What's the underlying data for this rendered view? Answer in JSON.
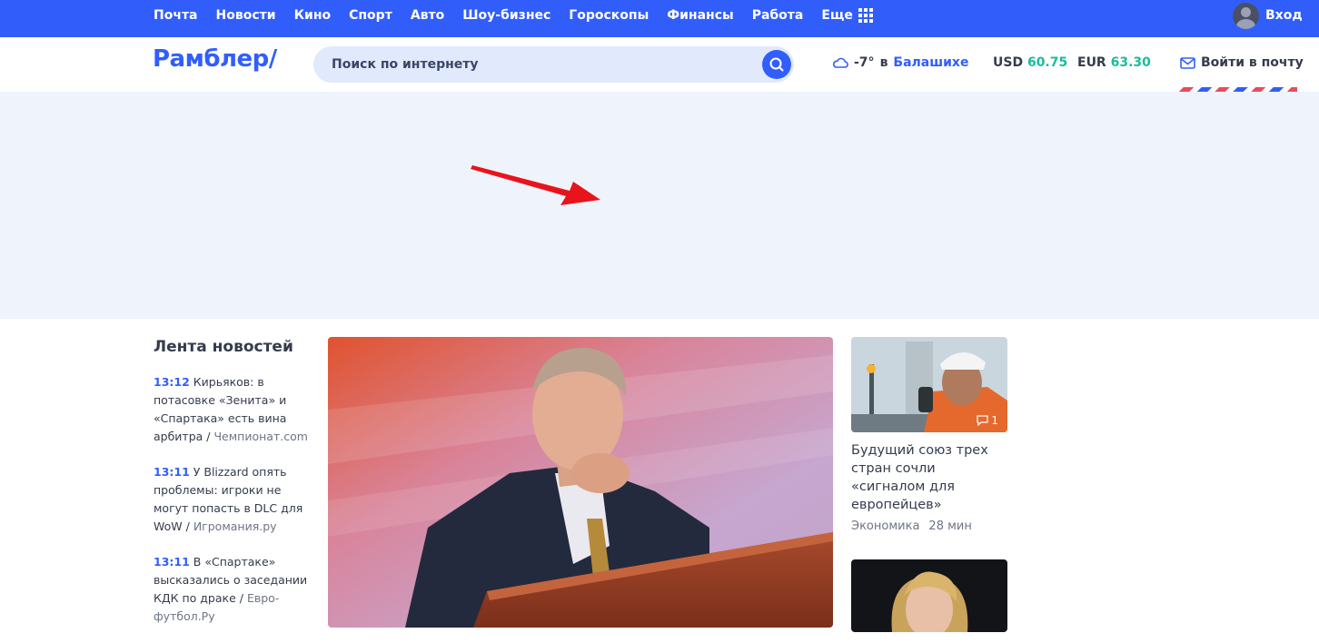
{
  "topnav": {
    "items": [
      "Почта",
      "Новости",
      "Кино",
      "Спорт",
      "Авто",
      "Шоу-бизнес",
      "Гороскопы",
      "Финансы",
      "Работа"
    ],
    "more_label": "Еще",
    "login_label": "Вход"
  },
  "header": {
    "logo": "Рамблер/",
    "search_placeholder": "Поиск по интернету",
    "weather": {
      "temp": "-7°",
      "prep": "в",
      "city": "Балашихе"
    },
    "currencies": [
      {
        "code": "USD",
        "value": "60.75"
      },
      {
        "code": "EUR",
        "value": "63.30"
      }
    ],
    "mail_label": "Войти в почту"
  },
  "colors": {
    "brand": "#315efb",
    "accent_green": "#1bbc9b",
    "ad_bg": "#eef3fc",
    "arrow": "#e8141c"
  },
  "feed": {
    "title": "Лента новостей",
    "items": [
      {
        "time": "13:12",
        "text": "Кирьяков: в потасовке «Зенита» и «Спартака» есть вина арбитра",
        "source": "Чемпионат.com"
      },
      {
        "time": "13:11",
        "text": "У Blizzard опять проблемы: игроки не могут попасть в DLC для WoW",
        "source": "Игромания.ру"
      },
      {
        "time": "13:11",
        "text": "В «Спартаке» высказались о заседании КДК по драке",
        "source": "Евро-футбол.Ру"
      }
    ]
  },
  "cards": [
    {
      "title": "Будущий союз трех стран сочли «сигналом для европейцев»",
      "category": "Экономика",
      "time": "28 мин",
      "comments": "1"
    }
  ]
}
